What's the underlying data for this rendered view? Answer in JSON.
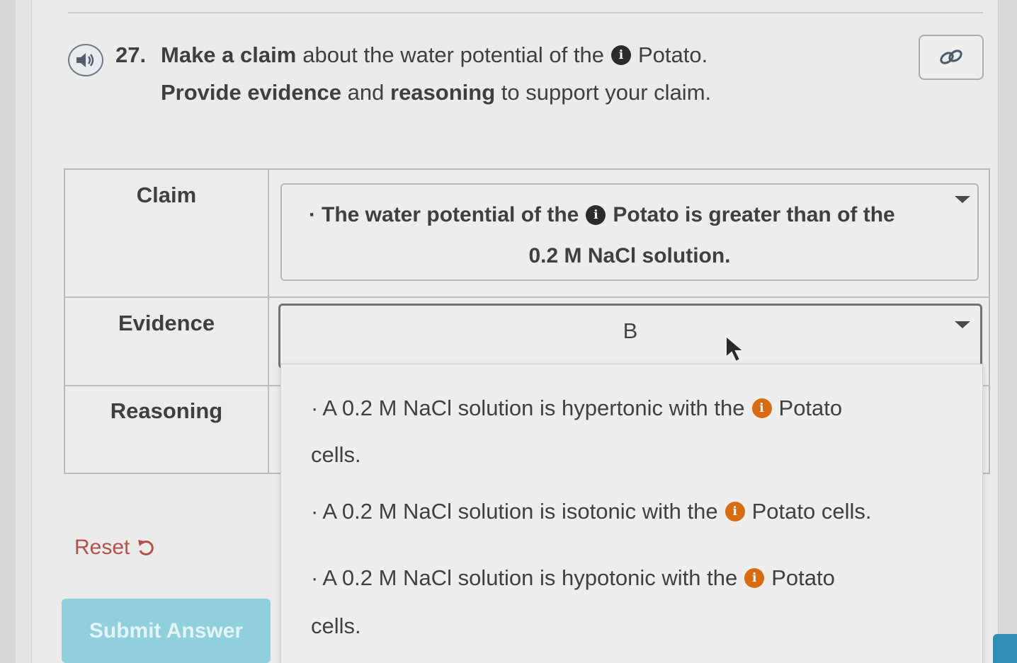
{
  "question": {
    "number": "27.",
    "line1_bold": "Make a claim",
    "line1_pre": "about the water potential of the",
    "line1_post": "Potato.",
    "line2_bold1": "Provide evidence",
    "line2_mid": "and",
    "line2_bold2": "reasoning",
    "line2_post": "to support your claim."
  },
  "icons": {
    "audio": "speaker-icon",
    "link": "link-icon",
    "info": "info-icon",
    "reset": "undo-icon"
  },
  "table": {
    "rows": [
      {
        "label": "Claim"
      },
      {
        "label": "Evidence"
      },
      {
        "label": "Reasoning"
      }
    ],
    "claim": {
      "part1": "The water potential of the",
      "part2": "Potato is greater than of the",
      "line2": "0.2 M NaCl solution."
    },
    "evidence": {
      "selected": "B"
    }
  },
  "dropdown": {
    "options": [
      {
        "pre": "A 0.2 M NaCl solution is hypertonic with the",
        "post": "Potato",
        "cont": "cells."
      },
      {
        "pre": "A 0.2 M NaCl solution is isotonic with the",
        "post": "Potato cells.",
        "cont": ""
      },
      {
        "pre": "A 0.2 M NaCl solution is hypotonic with the",
        "post": "Potato",
        "cont": "cells."
      }
    ]
  },
  "actions": {
    "reset_label": "Reset",
    "submit_label": "Submit Answer"
  },
  "colors": {
    "info_dark": "#2b2b2b",
    "info_orange": "#d96b12",
    "reset": "#b1504d",
    "submit_bg": "#8fd0dc"
  }
}
